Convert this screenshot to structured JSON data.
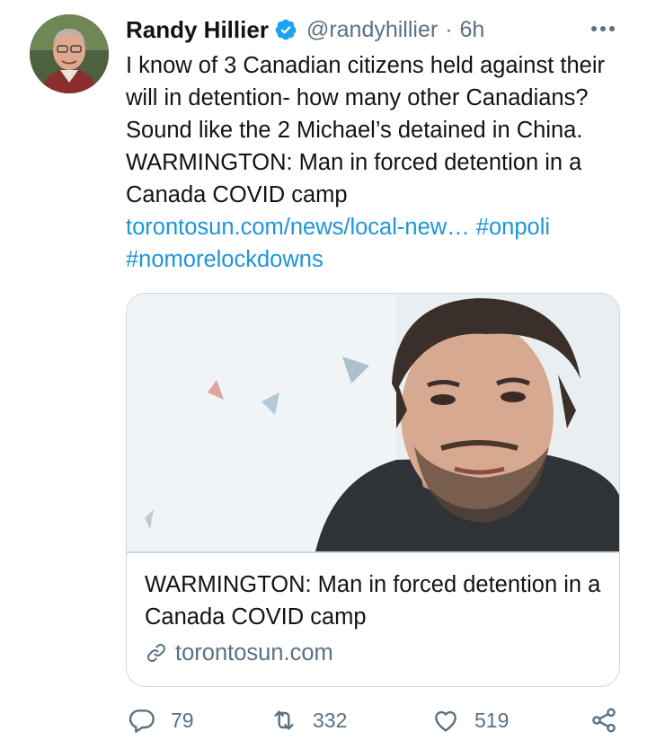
{
  "tweet": {
    "author": {
      "name": "Randy Hillier",
      "handle": "@randyhillier",
      "verified": true
    },
    "separator": "·",
    "time": "6h",
    "text_plain": "I know of 3 Canadian citizens held against their will in detention- how many other Canadians? Sound like the 2 Michael’s detained in China. WARMINGTON: Man in forced detention in a Canada COVID camp ",
    "link": "torontosun.com/news/local-new…",
    "hashtags": [
      "#onpoli",
      "#nomorelockdowns"
    ]
  },
  "card": {
    "title": "WARMINGTON: Man in forced detention in a Canada COVID camp",
    "domain": "torontosun.com"
  },
  "actions": {
    "replies": "79",
    "retweets": "332",
    "likes": "519"
  },
  "colors": {
    "link": "#1b95e0",
    "verified": "#1da1f2",
    "secondary_text": "#5b7083",
    "border": "#cfd9de"
  },
  "icons": [
    "verified-badge-icon",
    "more-icon",
    "link-icon",
    "reply-icon",
    "retweet-icon",
    "like-icon",
    "share-icon"
  ]
}
